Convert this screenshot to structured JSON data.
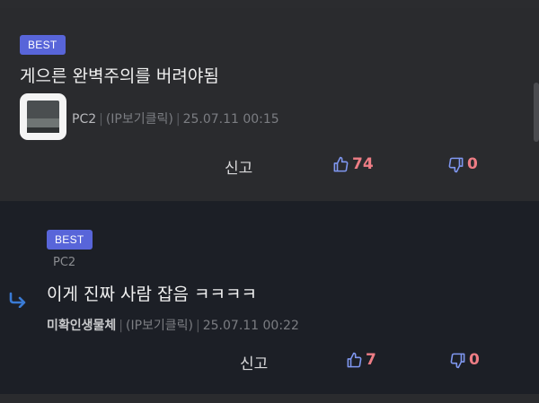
{
  "comments": [
    {
      "badge": "BEST",
      "text": "게으른 완벽주의를 버려야됨",
      "author": "PC2",
      "ip": "(IP보기클릭)",
      "time": "25.07.11 00:15",
      "report_label": "신고",
      "upvotes": "74",
      "downvotes": "0"
    },
    {
      "badge": "BEST",
      "parent_author": "PC2",
      "text": "이게 진짜 사람 잡음 ㅋㅋㅋㅋ",
      "author": "미확인생물체",
      "ip": "(IP보기클릭)",
      "time": "25.07.11 00:22",
      "report_label": "신고",
      "upvotes": "7",
      "downvotes": "0"
    }
  ],
  "separators": {
    "bar": "|"
  },
  "colors": {
    "badge": "#5865d9",
    "upvote_icon": "#7f97f0",
    "count": "#ee7d85",
    "reply_arrow": "#3a7bd5"
  },
  "icons": {
    "upvote": "thumbs-up-icon",
    "downvote": "thumbs-down-icon",
    "reply": "reply-arrow-icon"
  }
}
